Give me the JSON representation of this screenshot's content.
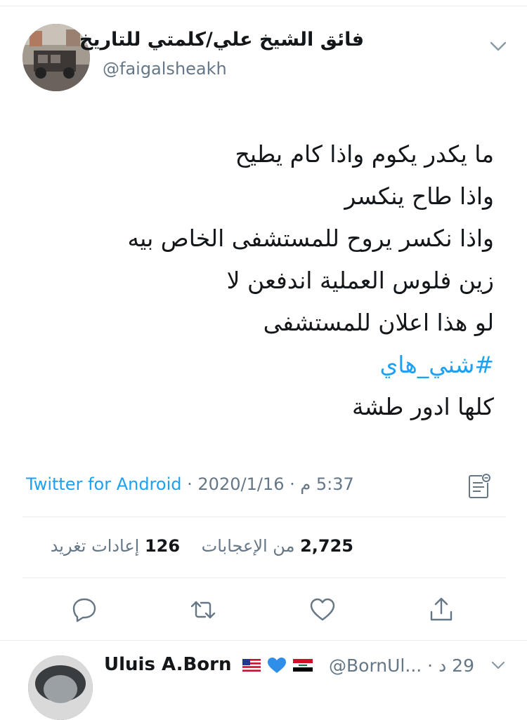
{
  "tweet": {
    "display_name": "فائق الشيخ علي/كلمتي للتاريخ",
    "handle": "@faigalsheakh",
    "lines": [
      "ما يكدر يكوم واذا كام يطيح",
      "واذا طاح ينكسر",
      "واذا نكسر يروح للمستشفى الخاص بيه",
      "زين فلوس العملية اندفعن لا",
      "لو هذا اعلان للمستشفى",
      "#شني_هاي",
      "كلها ادور طشة"
    ],
    "source": "Twitter for Android",
    "separator": "·",
    "date": "2020/1/16",
    "time": "5:37 م"
  },
  "stats": {
    "likes_count": "2,725",
    "likes_label": "من الإعجابات",
    "retweets_count": "126",
    "retweets_label": "إعادات تغريد"
  },
  "reply": {
    "name": "Uluis A.Born",
    "handle": "@BornUl...",
    "separator": "·",
    "time": "29 د"
  },
  "colors": {
    "accent": "#1da1f2",
    "secondary_text": "#657786",
    "divider": "#e6ecf0",
    "primary_text": "#14171a"
  },
  "icons": {
    "reply": "reply-icon",
    "retweet": "retweet-icon",
    "like": "heart-icon",
    "share": "share-icon",
    "analytics": "analytics-icon",
    "more": "chevron-down-icon"
  }
}
